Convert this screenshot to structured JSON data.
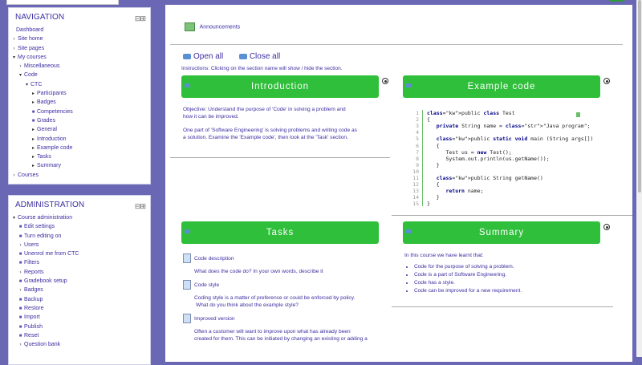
{
  "navigation": {
    "title": "NAVIGATION",
    "items": [
      {
        "label": "Dashboard",
        "arrow": ""
      },
      {
        "label": "Site home",
        "arrow": "›"
      },
      {
        "label": "Site pages",
        "arrow": "›"
      },
      {
        "label": "My courses",
        "arrow": "▾"
      },
      {
        "label": "Miscellaneous",
        "arrow": "›"
      },
      {
        "label": "Code",
        "arrow": "▾"
      },
      {
        "label": "CTC",
        "arrow": "▾"
      },
      {
        "label": "Participants",
        "arrow": "▸"
      },
      {
        "label": "Badges",
        "arrow": "▸"
      },
      {
        "label": "Competencies",
        "arrow": ""
      },
      {
        "label": "Grades",
        "arrow": ""
      },
      {
        "label": "General",
        "arrow": "▸"
      },
      {
        "label": "Introduction",
        "arrow": "▸"
      },
      {
        "label": "Example code",
        "arrow": "▸"
      },
      {
        "label": "Tasks",
        "arrow": "▸"
      },
      {
        "label": "Summary",
        "arrow": "▸"
      },
      {
        "label": "Courses",
        "arrow": "›"
      }
    ]
  },
  "administration": {
    "title": "ADMINISTRATION",
    "items": [
      {
        "label": "Course administration",
        "arrow": "▾"
      },
      {
        "label": "Edit settings"
      },
      {
        "label": "Turn editing on"
      },
      {
        "label": "Users",
        "arrow": "›"
      },
      {
        "label": "Unenrol me from CTC"
      },
      {
        "label": "Filters"
      },
      {
        "label": "Reports",
        "arrow": "›"
      },
      {
        "label": "Gradebook setup"
      },
      {
        "label": "Badges",
        "arrow": "›"
      },
      {
        "label": "Backup"
      },
      {
        "label": "Restore"
      },
      {
        "label": "Import"
      },
      {
        "label": "Publish"
      },
      {
        "label": "Reset"
      },
      {
        "label": "Question bank",
        "arrow": "›"
      }
    ]
  },
  "main": {
    "announcements": "Announcements",
    "open_all": "Open all",
    "close_all": "Close all",
    "instructions": "Instructions: Clicking on the section name will show / hide the section.",
    "sections": {
      "introduction": {
        "title": "Introduction",
        "p1a": "Objective: Understand the purpose of 'Code' in solving a problem and",
        "p1b": "how it can be improved.",
        "p2a": "One part of 'Software Engineering' is solving problems and writing code as",
        "p2b": "a solution.  Examine the 'Example code', then look at the 'Task' section."
      },
      "example_code": {
        "title": "Example code",
        "lines": [
          "public class Test",
          "{",
          "   private String name = \"Java program\";",
          "",
          "   public static void main (String args[])",
          "   {",
          "      Test us = new Test();",
          "      System.out.println(us.getName());",
          "   }",
          "",
          "   public String getName()",
          "   {",
          "      return name;",
          "   }",
          "}"
        ]
      },
      "tasks": {
        "title": "Tasks",
        "items": [
          {
            "label": "Code description",
            "desc1": "What does the code do?  In your own words, describe it",
            "desc2": ""
          },
          {
            "label": "Code style",
            "desc1": "Coding style is a matter of preference or could be enforced by policy.",
            "desc2": "What do you think about the example style?"
          },
          {
            "label": "Improved version",
            "desc1": "Often a customer will want to improve upon what has already been",
            "desc2": "created for them.  This can be initiated by changing an existing or adding a"
          }
        ]
      },
      "summary": {
        "title": "Summary",
        "intro": "In this course we have learnt that:",
        "bullets": [
          "Code for the purpose of solving a problem.",
          "Code is a part of Software Engineering.",
          "Code has a style.",
          "Code can be improved for a new requirement."
        ]
      }
    }
  }
}
